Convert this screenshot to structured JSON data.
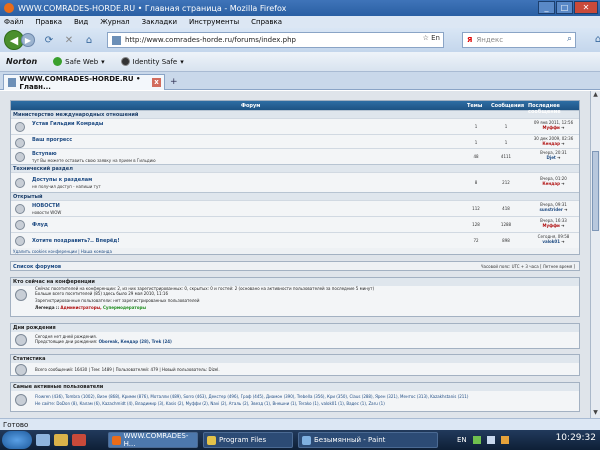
{
  "window": {
    "title": "WWW.COMRADES-HORDE.RU • Главная страница - Mozilla Firefox",
    "buttons": [
      "_",
      "□",
      "✕"
    ]
  },
  "menu": [
    "Файл",
    "Правка",
    "Вид",
    "Журнал",
    "Закладки",
    "Инструменты",
    "Справка"
  ],
  "nav": {
    "url": "http://www.comrades-horde.ru/forums/index.php",
    "url_right": "☆ En",
    "search_placeholder": "Яндекс",
    "search_logo": "Я"
  },
  "norton": {
    "logo": "Norton",
    "items": [
      "Safe Web",
      "Identity Safe"
    ]
  },
  "tab": {
    "label": "WWW.COMRADES-HORDE.RU • Главн...",
    "close": "x",
    "new_tab": "+"
  },
  "forum": {
    "headers": {
      "forum": "Форум",
      "topics": "Темы",
      "messages": "Сообщения",
      "last": "Последнее сообщение"
    },
    "sections": [
      {
        "name": "Министерство международных отношений",
        "rows": [
          {
            "title": "Устав Гильдии Комрады",
            "desc": "",
            "topics": "1",
            "msgs": "1",
            "last_date": "09 янв 2011, 12:56",
            "last_user": "Муффи"
          },
          {
            "title": "Ваш прогресс",
            "desc": "",
            "topics": "1",
            "msgs": "1",
            "last_date": "30 дек 2009, 02:36",
            "last_user": "Кендар"
          },
          {
            "title": "Вступаю",
            "desc": "тут Вы можете оставить свою заявку на прием в Гильдию",
            "topics": "48",
            "msgs": "4111",
            "last_date": "Вчера, 20:31",
            "last_user": "Djet"
          }
        ]
      },
      {
        "name": "Технический раздел",
        "rows": [
          {
            "title": "Доступы к разделам",
            "desc": "не получил доступ - напиши тут",
            "topics": "8",
            "msgs": "212",
            "last_date": "Вчера, 01:20",
            "last_user": "Кендар"
          }
        ]
      },
      {
        "name": "Открытый",
        "rows": [
          {
            "title": "НОВОСТИ",
            "desc": "новости WOW",
            "topics": "112",
            "msgs": "418",
            "last_date": "Вчера, 09:31",
            "last_user": "sunstrider"
          },
          {
            "title": "Флуд",
            "desc": "",
            "topics": "128",
            "msgs": "1288",
            "last_date": "Вчера, 16:33",
            "last_user": "Муффи"
          },
          {
            "title": "Хотите поздравить?.. Вперёд!",
            "desc": "",
            "topics": "72",
            "msgs": "898",
            "last_date": "Сегодня, 09:58",
            "last_user": "valok01"
          }
        ]
      }
    ],
    "bottom_links": "Удалить cookies конференции | Наша команда",
    "list_label": "Список форумов",
    "timezone": "Часовой пояс: UTC + 3 часа [ Летнее время ]"
  },
  "online": {
    "header": "Кто сейчас на конференции",
    "line1": "Сейчас посетителей на конференции: 2, из них зарегистрированных: 0, скрытых: 0 и гостей: 2 (основано на активности пользователей за последние 5 минут)",
    "line2": "Больше всего посетителей (85) здесь было 29 мая 2010, 11:16",
    "line3": "Зарегистрированные пользователи: нет зарегистрированных пользователей",
    "legend_label": "Легенда ::",
    "legend_admins": "Администраторы,",
    "legend_supers": "Супермодераторы"
  },
  "birthdays": {
    "header": "Дни рождения",
    "line1": "Сегодня нет дней рождения.",
    "line2_prefix": "Предстоящие дни рождения:",
    "names": "Oboreak, Кендар (28), Trek (24)"
  },
  "stats": {
    "header": "Статистика",
    "text": "Всего сообщений: 16430 | Тем: 1489 | Пользователей: 479 | Новый пользователь: Dizel."
  },
  "active": {
    "header": "Самые активные пользователи",
    "line1": "Flowren (436), Tombra (1002), Виэн (868), Кримм (876), Моталли (489), Sorro (463), Декстер (496), Граф (445), Диамон (390), Trebella (356), Кри (350), Claus (288), Ярен (321), Ментос (313), Kazakhstanis (211)",
    "line2": "Не сайте: DoDon (8), Калам (6), Kazachmidt (4), Владимир (3), Kasis (2), Муффи (2), Navi (2), Аталь (2), Звезд (1), Внешни (1), Terako (1), valok01 (1), Вадес (1), Zaru (1)"
  },
  "status": "Готово",
  "taskbar": {
    "tasks": [
      "WWW.COMRADES-H...",
      "Program Files",
      "Безымянный - Paint"
    ],
    "lang": "EN",
    "clock": "10:29:32"
  },
  "colors": {
    "accent": "#2e6da4",
    "red_user": "#b01010",
    "green": "#1c8c1c"
  }
}
